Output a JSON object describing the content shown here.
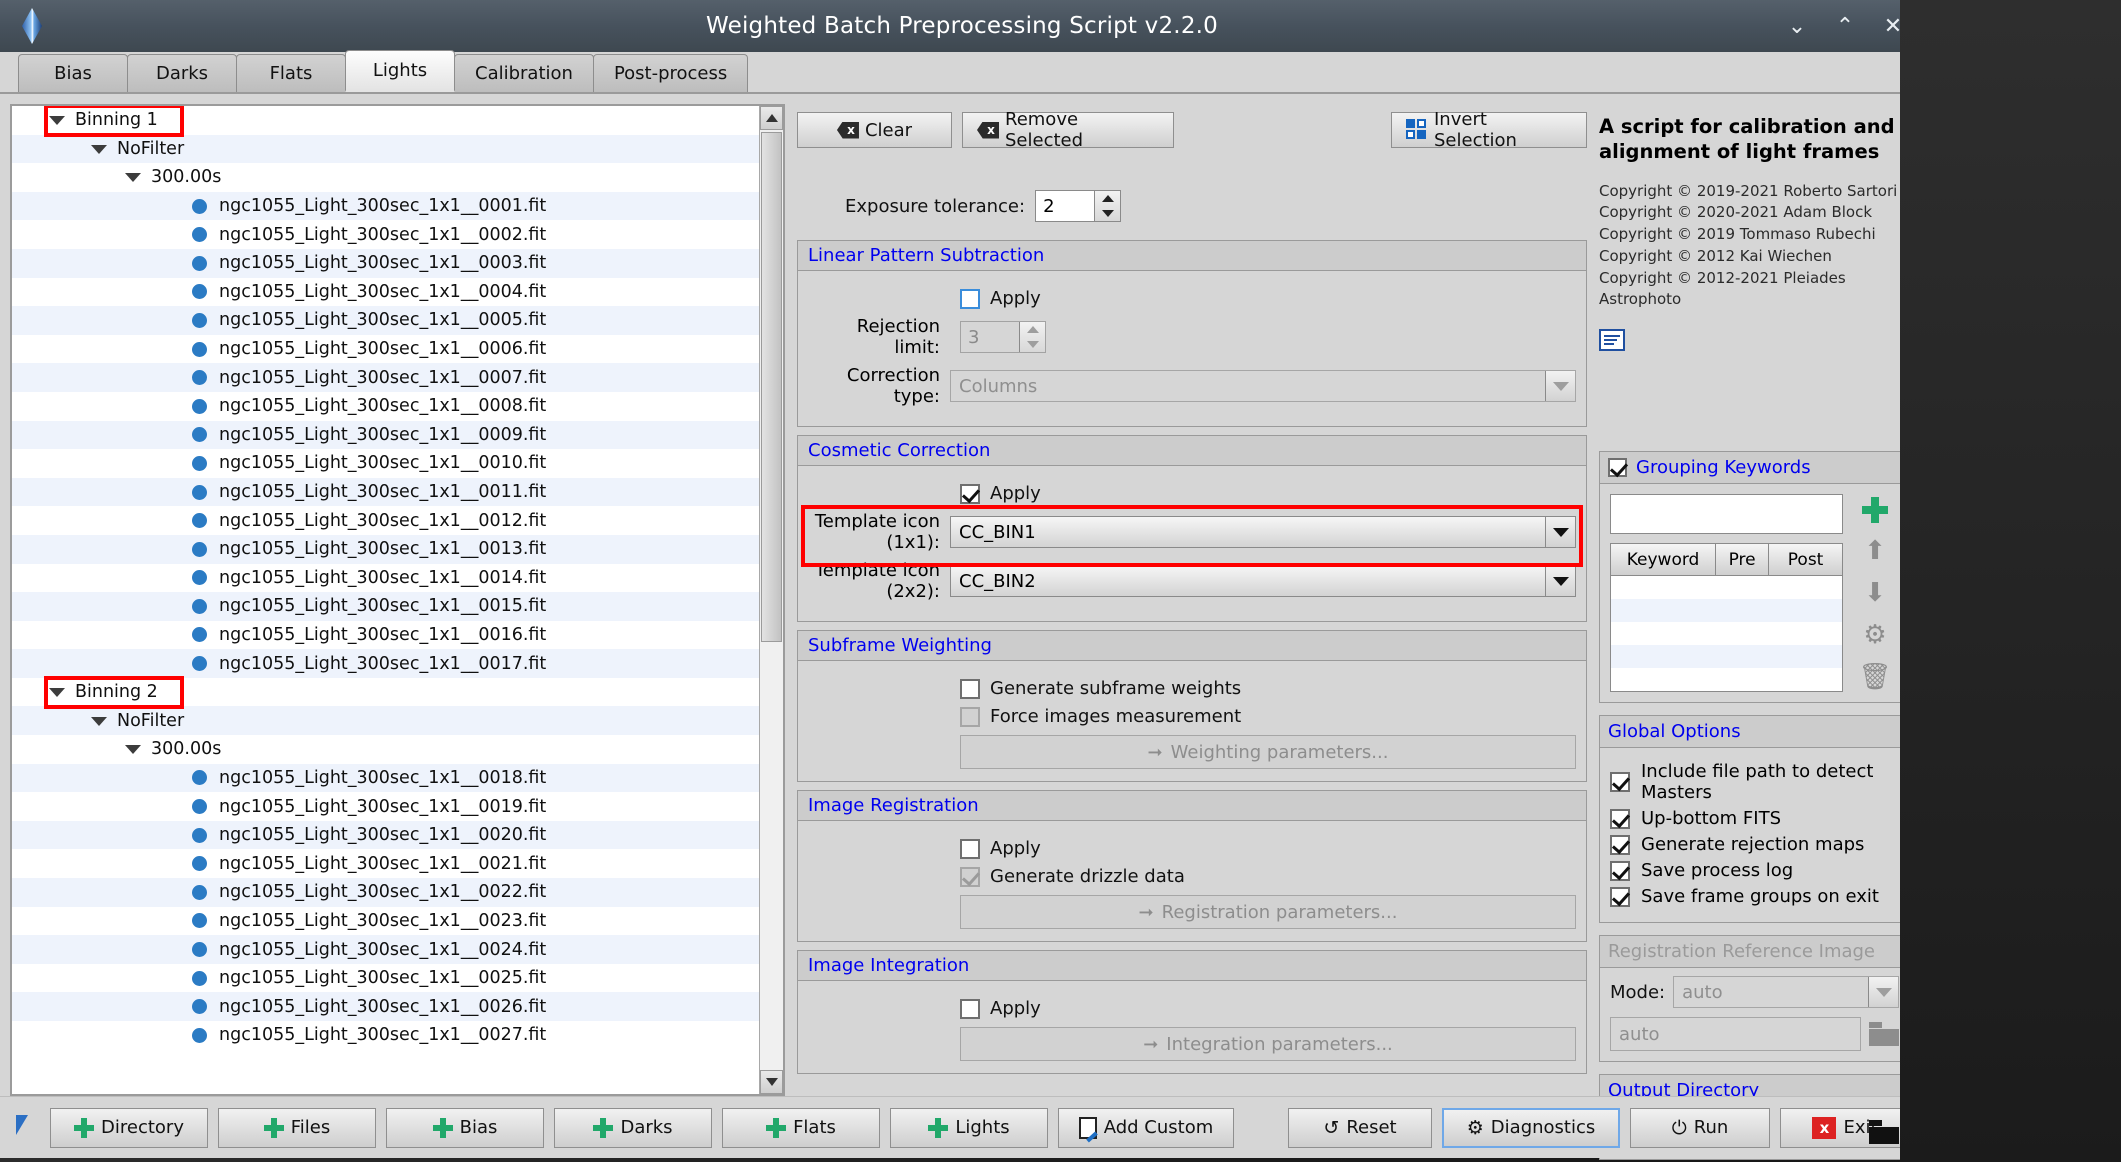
{
  "window": {
    "title": "Weighted Batch Preprocessing Script v2.2.0",
    "minimize": "⌄",
    "maximize": "⌃",
    "close": "✕"
  },
  "tabs": [
    {
      "label": "Bias",
      "active": false
    },
    {
      "label": "Darks",
      "active": false
    },
    {
      "label": "Flats",
      "active": false
    },
    {
      "label": "Lights",
      "active": true
    },
    {
      "label": "Calibration",
      "active": false
    },
    {
      "label": "Post-process",
      "active": false
    }
  ],
  "tree": {
    "groups": [
      {
        "name": "Binning 1",
        "filter": "NoFilter",
        "exposure": "300.00s",
        "files": [
          "ngc1055_Light_300sec_1x1__0001.fit",
          "ngc1055_Light_300sec_1x1__0002.fit",
          "ngc1055_Light_300sec_1x1__0003.fit",
          "ngc1055_Light_300sec_1x1__0004.fit",
          "ngc1055_Light_300sec_1x1__0005.fit",
          "ngc1055_Light_300sec_1x1__0006.fit",
          "ngc1055_Light_300sec_1x1__0007.fit",
          "ngc1055_Light_300sec_1x1__0008.fit",
          "ngc1055_Light_300sec_1x1__0009.fit",
          "ngc1055_Light_300sec_1x1__0010.fit",
          "ngc1055_Light_300sec_1x1__0011.fit",
          "ngc1055_Light_300sec_1x1__0012.fit",
          "ngc1055_Light_300sec_1x1__0013.fit",
          "ngc1055_Light_300sec_1x1__0014.fit",
          "ngc1055_Light_300sec_1x1__0015.fit",
          "ngc1055_Light_300sec_1x1__0016.fit",
          "ngc1055_Light_300sec_1x1__0017.fit"
        ]
      },
      {
        "name": "Binning 2",
        "filter": "NoFilter",
        "exposure": "300.00s",
        "files": [
          "ngc1055_Light_300sec_1x1__0018.fit",
          "ngc1055_Light_300sec_1x1__0019.fit",
          "ngc1055_Light_300sec_1x1__0020.fit",
          "ngc1055_Light_300sec_1x1__0021.fit",
          "ngc1055_Light_300sec_1x1__0022.fit",
          "ngc1055_Light_300sec_1x1__0023.fit",
          "ngc1055_Light_300sec_1x1__0024.fit",
          "ngc1055_Light_300sec_1x1__0025.fit",
          "ngc1055_Light_300sec_1x1__0026.fit",
          "ngc1055_Light_300sec_1x1__0027.fit"
        ]
      }
    ]
  },
  "toolbar": {
    "clear": "Clear",
    "remove_selected": "Remove Selected",
    "invert_selection": "Invert Selection"
  },
  "exposure_tolerance": {
    "label": "Exposure tolerance:",
    "value": "2"
  },
  "linear_pattern_subtraction": {
    "title": "Linear Pattern Subtraction",
    "apply_label": "Apply",
    "apply_checked": false,
    "rejection_limit_label": "Rejection limit:",
    "rejection_limit_value": "3",
    "correction_type_label": "Correction type:",
    "correction_type_value": "Columns"
  },
  "cosmetic_correction": {
    "title": "Cosmetic Correction",
    "apply_label": "Apply",
    "apply_checked": true,
    "template_1x1_label": "Template icon (1x1):",
    "template_1x1_value": "CC_BIN1",
    "template_2x2_label": "Template icon (2x2):",
    "template_2x2_value": "CC_BIN2",
    "highlight_color": "#ff0000"
  },
  "subframe_weighting": {
    "title": "Subframe Weighting",
    "generate_label": "Generate subframe weights",
    "generate_checked": false,
    "force_label": "Force images measurement",
    "force_checked": false,
    "params_button": "Weighting parameters..."
  },
  "image_registration": {
    "title": "Image Registration",
    "apply_label": "Apply",
    "apply_checked": false,
    "drizzle_label": "Generate drizzle data",
    "drizzle_checked": true,
    "params_button": "Registration parameters..."
  },
  "image_integration": {
    "title": "Image Integration",
    "apply_label": "Apply",
    "apply_checked": false,
    "params_button": "Integration parameters..."
  },
  "description": {
    "heading": "A script for calibration and alignment of light frames",
    "copyrights": [
      "Copyright © 2019-2021 Roberto Sartori",
      "Copyright © 2020-2021 Adam Block",
      "Copyright © 2019 Tommaso Rubechi",
      "Copyright © 2012 Kai Wiechen",
      "Copyright © 2012-2021 Pleiades Astrophoto"
    ]
  },
  "grouping_keywords": {
    "title": "Grouping Keywords",
    "enabled": true,
    "input_value": "",
    "columns": [
      "Keyword",
      "Pre",
      "Post"
    ],
    "rows": []
  },
  "global_options": {
    "title": "Global Options",
    "items": [
      {
        "label": "Include file path to detect Masters",
        "checked": true
      },
      {
        "label": "Up-bottom FITS",
        "checked": true
      },
      {
        "label": "Generate rejection maps",
        "checked": true
      },
      {
        "label": "Save process log",
        "checked": true
      },
      {
        "label": "Save frame groups on exit",
        "checked": true
      }
    ]
  },
  "registration_reference": {
    "title": "Registration Reference Image",
    "mode_label": "Mode:",
    "mode_value": "auto",
    "path_value": "auto"
  },
  "output_directory": {
    "title": "Output Directory",
    "path_value": ""
  },
  "footer": {
    "buttons": [
      {
        "label": "Directory",
        "icon": "plus-icon"
      },
      {
        "label": "Files",
        "icon": "plus-icon"
      },
      {
        "label": "Bias",
        "icon": "plus-icon"
      },
      {
        "label": "Darks",
        "icon": "plus-icon"
      },
      {
        "label": "Flats",
        "icon": "plus-icon"
      },
      {
        "label": "Lights",
        "icon": "plus-icon"
      },
      {
        "label": "Add Custom",
        "icon": "document-pencil-icon"
      }
    ],
    "reset": "Reset",
    "diagnostics": "Diagnostics",
    "run": "Run",
    "exit": "Exit",
    "reset_icon": "↺",
    "diagnostics_icon": "⚙",
    "run_icon": "⏻"
  },
  "desktop_icons": [
    {
      "label": "CC_BIN1"
    },
    {
      "label": "CC_BIN2"
    }
  ]
}
